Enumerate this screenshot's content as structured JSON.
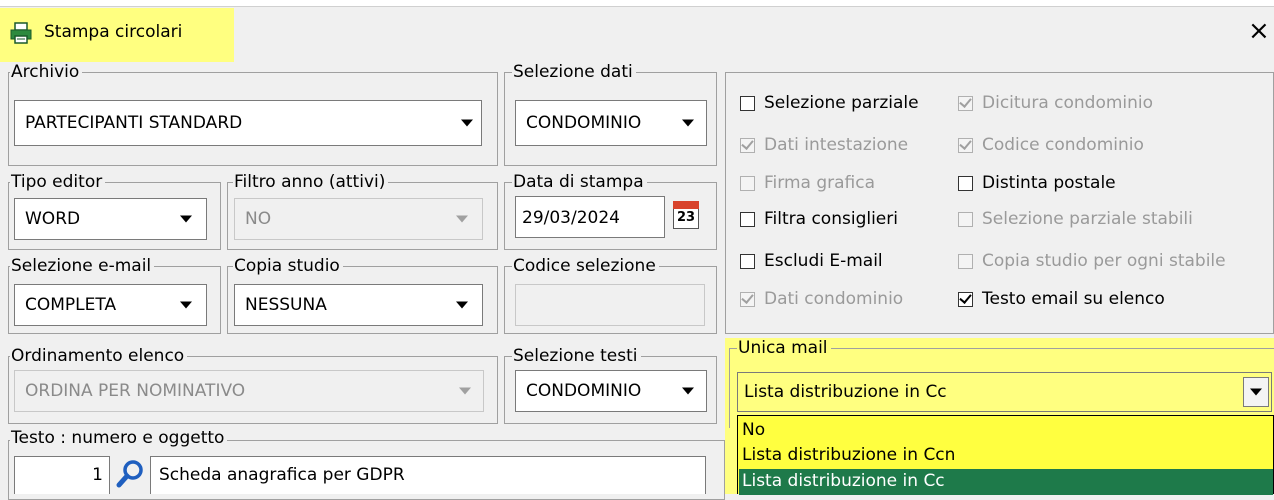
{
  "window": {
    "title": "Stampa circolari",
    "close_icon": "×",
    "highlight_color": "#ffff80"
  },
  "archivio": {
    "label": "Archivio",
    "value": "PARTECIPANTI STANDARD"
  },
  "selezione_dati": {
    "label": "Selezione dati",
    "value": "CONDOMINIO"
  },
  "tipo_editor": {
    "label": "Tipo editor",
    "value": "WORD"
  },
  "filtro_anno": {
    "label": "Filtro anno (attivi)",
    "value": "NO"
  },
  "data_stampa": {
    "label": "Data di stampa",
    "value": "29/03/2024",
    "calendar_day": "23"
  },
  "selezione_email": {
    "label": "Selezione e-mail",
    "value": "COMPLETA"
  },
  "copia_studio": {
    "label": "Copia studio",
    "value": "NESSUNA"
  },
  "codice_selezione": {
    "label": "Codice selezione",
    "value": ""
  },
  "ordinamento": {
    "label": "Ordinamento elenco",
    "value": "ORDINA PER NOMINATIVO"
  },
  "selezione_testi": {
    "label": "Selezione testi",
    "value": "CONDOMINIO"
  },
  "testo": {
    "label": "Testo : numero e oggetto",
    "numero": "1",
    "oggetto": "Scheda anagrafica per GDPR"
  },
  "checkboxes": [
    {
      "label": "Selezione parziale",
      "checked": false,
      "enabled": true
    },
    {
      "label": "Dicitura condominio",
      "checked": true,
      "enabled": false
    },
    {
      "label": "Dati intestazione",
      "checked": true,
      "enabled": false
    },
    {
      "label": "Codice condominio",
      "checked": true,
      "enabled": false
    },
    {
      "label": "Firma grafica",
      "checked": false,
      "enabled": false
    },
    {
      "label": "Distinta postale",
      "checked": false,
      "enabled": true
    },
    {
      "label": "Filtra consiglieri",
      "checked": false,
      "enabled": true
    },
    {
      "label": "Selezione parziale stabili",
      "checked": false,
      "enabled": false
    },
    {
      "label": "Escludi E-mail",
      "checked": false,
      "enabled": true
    },
    {
      "label": "Copia studio per ogni stabile",
      "checked": false,
      "enabled": false
    },
    {
      "label": "Dati condominio",
      "checked": true,
      "enabled": false
    },
    {
      "label": "Testo email su elenco",
      "checked": true,
      "enabled": true
    }
  ],
  "unica_mail": {
    "label": "Unica mail",
    "value": "Lista distribuzione in Cc",
    "options": [
      "No",
      "Lista distribuzione in Ccn",
      "Lista distribuzione in Cc"
    ],
    "selected_color": "#1e7a4a"
  }
}
